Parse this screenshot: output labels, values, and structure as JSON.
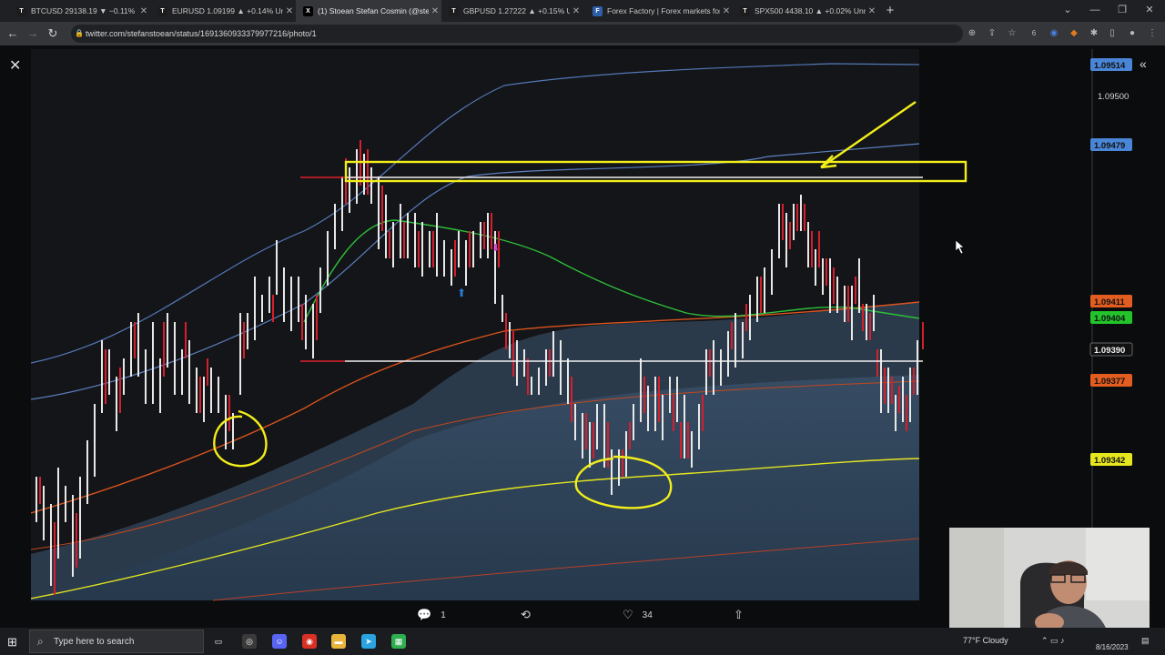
{
  "browser": {
    "tabs": [
      {
        "label": "BTCUSD 29138.19 ▼ −0.11% Unn…",
        "icon": "tradingview-icon",
        "active": false
      },
      {
        "label": "EURUSD 1.09199 ▲ +0.14% Unn…",
        "icon": "tradingview-icon",
        "active": false
      },
      {
        "label": "(1) Stoean Stefan Cosmin (@stef…",
        "icon": "x-logo-icon",
        "active": true
      },
      {
        "label": "GBPUSD 1.27222 ▲ +0.15% Unn…",
        "icon": "tradingview-icon",
        "active": false
      },
      {
        "label": "Forex Factory | Forex markets for…",
        "icon": "forexfactory-icon",
        "active": false
      },
      {
        "label": "SPX500 4438.10 ▲ +0.02% Unn…",
        "icon": "tradingview-icon",
        "active": false
      }
    ],
    "url": "twitter.com/stefanstoean/status/1691360933379977216/photo/1",
    "profile_badge": "6"
  },
  "chart": {
    "price_labels": [
      {
        "text": "1.09514",
        "color": "#4a86d8"
      },
      {
        "text": "1.09500",
        "color": "plain"
      },
      {
        "text": "1.09479",
        "color": "#4a86d8"
      },
      {
        "text": "1.09411",
        "color": "#e25d1f"
      },
      {
        "text": "1.09404",
        "color": "#22c32b"
      },
      {
        "text": "1.09390",
        "color": "#111111"
      },
      {
        "text": "1.09377",
        "color": "#e25d1f"
      },
      {
        "text": "1.09342",
        "color": "#e6e61e"
      }
    ]
  },
  "tweet_actions": {
    "replies": "1",
    "likes": "34"
  },
  "taskbar": {
    "search_placeholder": "Type here to search",
    "weather": "77°F Cloudy",
    "date": "8/16/2023"
  }
}
